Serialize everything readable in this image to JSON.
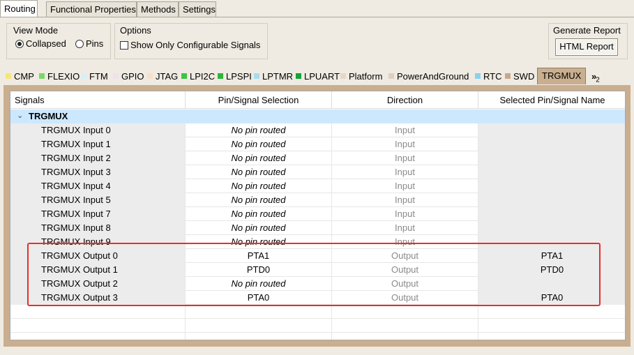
{
  "top_tabs": [
    {
      "label": "Routing",
      "active": true
    },
    {
      "label": "Functional Properties",
      "active": false
    },
    {
      "label": "Methods",
      "active": false
    },
    {
      "label": "Settings",
      "active": false
    }
  ],
  "view_mode": {
    "title": "View Mode",
    "options": [
      {
        "label": "Collapsed",
        "selected": true
      },
      {
        "label": "Pins",
        "selected": false
      }
    ]
  },
  "options": {
    "title": "Options",
    "show_configurable_label": "Show Only Configurable Signals",
    "show_configurable_checked": false
  },
  "report": {
    "title": "Generate Report",
    "button_label": "HTML Report"
  },
  "peripheral_tabs": [
    {
      "label": "CMP",
      "color": "#f5e67a"
    },
    {
      "label": "FLEXIO",
      "color": "#7bd86a"
    },
    {
      "label": "FTM",
      "color": "#d6f0f8"
    },
    {
      "label": "GPIO",
      "color": "#efe2f0"
    },
    {
      "label": "JTAG",
      "color": "#f7e0c8"
    },
    {
      "label": "LPI2C",
      "color": "#3cc444"
    },
    {
      "label": "LPSPI",
      "color": "#2db53a"
    },
    {
      "label": "LPTMR",
      "color": "#a9dcf0"
    },
    {
      "label": "LPUART",
      "color": "#13a535"
    },
    {
      "label": "Platform",
      "color": "#e8d6c6"
    },
    {
      "label": "PowerAndGround",
      "color": "#ddd0c2"
    },
    {
      "label": "RTC",
      "color": "#8ad0f2"
    },
    {
      "label": "SWD",
      "color": "#c6a98c"
    },
    {
      "label": "TRGMUX",
      "color": "",
      "active": true
    }
  ],
  "more_tabs": {
    "chevron": "»",
    "count": "2"
  },
  "table": {
    "columns": [
      "Signals",
      "Pin/Signal Selection",
      "Direction",
      "Selected Pin/Signal Name"
    ],
    "group": {
      "label": "TRGMUX",
      "expanded": true
    },
    "rows": [
      {
        "signal": "TRGMUX Input 0",
        "pin": "No pin routed",
        "direction": "Input",
        "selected": ""
      },
      {
        "signal": "TRGMUX Input 1",
        "pin": "No pin routed",
        "direction": "Input",
        "selected": ""
      },
      {
        "signal": "TRGMUX Input 2",
        "pin": "No pin routed",
        "direction": "Input",
        "selected": ""
      },
      {
        "signal": "TRGMUX Input 3",
        "pin": "No pin routed",
        "direction": "Input",
        "selected": ""
      },
      {
        "signal": "TRGMUX Input 4",
        "pin": "No pin routed",
        "direction": "Input",
        "selected": ""
      },
      {
        "signal": "TRGMUX Input 5",
        "pin": "No pin routed",
        "direction": "Input",
        "selected": ""
      },
      {
        "signal": "TRGMUX Input 7",
        "pin": "No pin routed",
        "direction": "Input",
        "selected": ""
      },
      {
        "signal": "TRGMUX Input 8",
        "pin": "No pin routed",
        "direction": "Input",
        "selected": ""
      },
      {
        "signal": "TRGMUX Input 9",
        "pin": "No pin routed",
        "direction": "Input",
        "selected": ""
      },
      {
        "signal": "TRGMUX Output 0",
        "pin": "PTA1",
        "direction": "Output",
        "selected": "PTA1"
      },
      {
        "signal": "TRGMUX Output 1",
        "pin": "PTD0",
        "direction": "Output",
        "selected": "PTD0"
      },
      {
        "signal": "TRGMUX Output 2",
        "pin": "No pin routed",
        "direction": "Output",
        "selected": ""
      },
      {
        "signal": "TRGMUX Output 3",
        "pin": "PTA0",
        "direction": "Output",
        "selected": "PTA0"
      }
    ]
  },
  "colors": {
    "active_tab": "#c9ae8f",
    "group_row": "#cce8ff",
    "highlight": "#e5302b"
  }
}
